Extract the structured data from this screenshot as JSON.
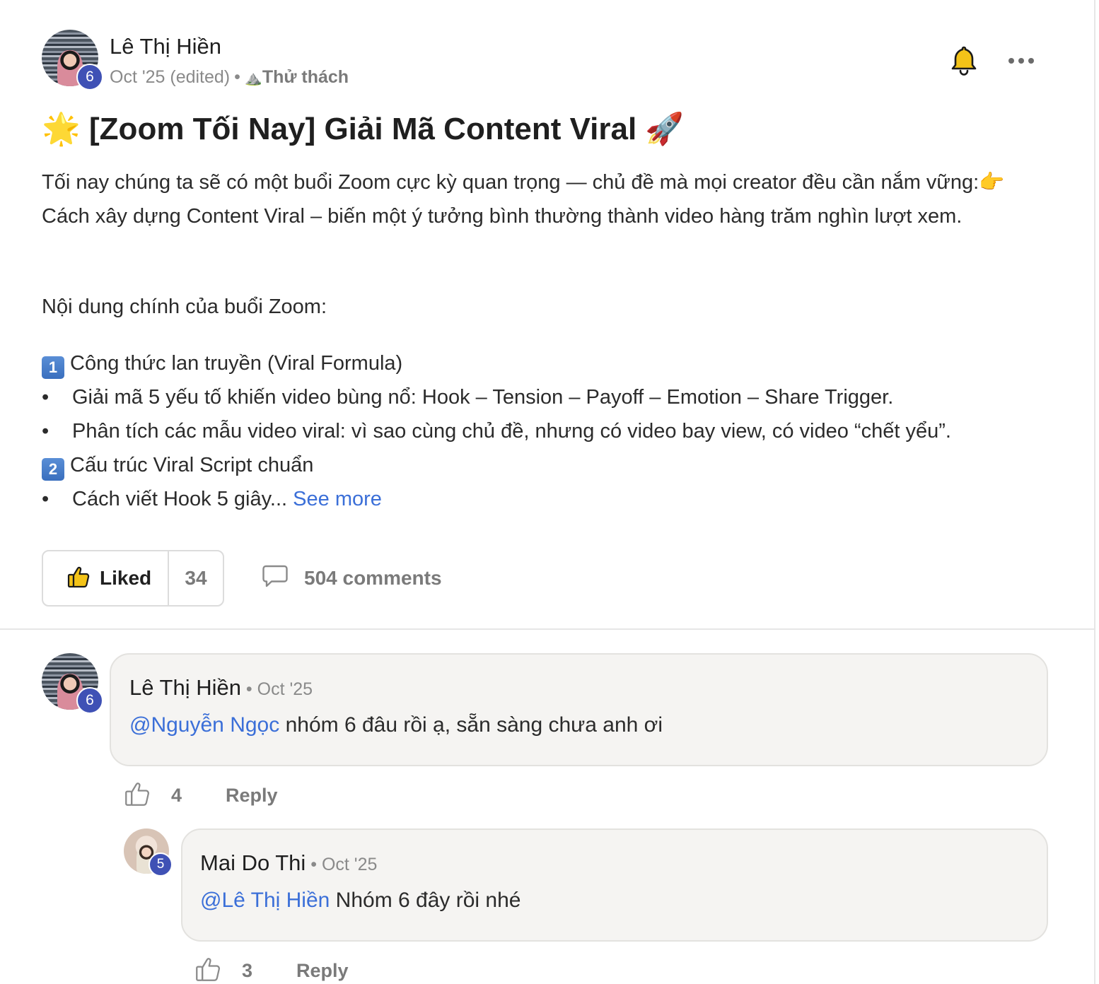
{
  "post": {
    "author": "Lê Thị Hiền",
    "level": "6",
    "date": "Oct '25 (edited)",
    "separator": "•",
    "category_emoji": "⛰️",
    "category": "Thử thách",
    "title_emoji_start": "🌟",
    "title": "[Zoom Tối Nay] Giải Mã Content Viral",
    "title_emoji_end": "🚀",
    "intro": "Tối nay chúng ta sẽ có một buổi Zoom cực kỳ quan trọng — chủ đề mà mọi creator đều cần nắm vững:👉 Cách xây dựng Content Viral – biến một ý tưởng bình thường thành video hàng trăm nghìn lượt xem.",
    "section_heading": "Nội dung chính của buổi Zoom:",
    "item1_num": "1",
    "item1_title": "Công thức lan truyền (Viral Formula)",
    "bullet_1": "Giải mã 5 yếu tố khiến video bùng nổ: Hook – Tension – Payoff – Emotion – Share Trigger.",
    "bullet_2": "Phân tích các mẫu video viral: vì sao cùng chủ đề, nhưng có video bay view, có video “chết yểu”.",
    "item2_num": "2",
    "item2_title": "Cấu trúc Viral Script chuẩn",
    "bullet_3": "Cách viết Hook 5 giây...",
    "bullet_char": "•",
    "see_more": "See more",
    "liked_label": "Liked",
    "like_count": "34",
    "comments_label": "504 comments"
  },
  "comments": [
    {
      "author": "Lê Thị Hiền",
      "level": "6",
      "date": "Oct '25",
      "mention": "@Nguyễn Ngọc",
      "text": " nhóm 6 đâu rồi ạ, sẵn sàng chưa anh ơi",
      "likes": "4",
      "reply_label": "Reply"
    },
    {
      "author": "Mai Do Thi",
      "level": "5",
      "date": "Oct '25",
      "mention": "@Lê Thị Hiền",
      "text": " Nhóm 6 đây rồi nhé",
      "likes": "3",
      "reply_label": "Reply"
    }
  ],
  "icons": {
    "bell": "bell-icon",
    "more": "more-horizontal-icon",
    "like": "thumbs-up-icon",
    "comment": "comment-bubble-icon"
  },
  "colors": {
    "level_badge": "#3f51b5",
    "link": "#3b6fd8",
    "bubble_bg": "#f5f4f2"
  }
}
